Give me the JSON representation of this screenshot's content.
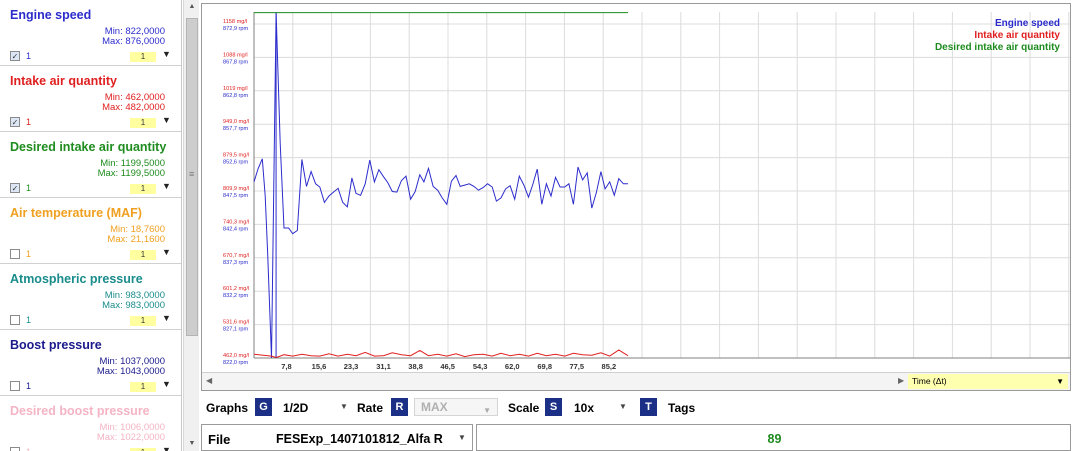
{
  "channels": [
    {
      "name": "Engine speed",
      "min": "Min: 822,0000",
      "max": "Max: 876,0000",
      "count": "1",
      "checked": true,
      "color": "#2c2ccc"
    },
    {
      "name": "Intake air quantity",
      "min": "Min: 462,0000",
      "max": "Max: 482,0000",
      "count": "1",
      "checked": true,
      "color": "#e02020"
    },
    {
      "name": "Desired intake air quantity",
      "min": "Min: 1199,5000",
      "max": "Max: 1199,5000",
      "count": "1",
      "checked": true,
      "color": "#1e8c1e"
    },
    {
      "name": "Air temperature (MAF)",
      "min": "Min: 18,7600",
      "max": "Max: 21,1600",
      "count": "1",
      "checked": false,
      "color": "#f0a020"
    },
    {
      "name": "Atmospheric pressure",
      "min": "Min: 983,0000",
      "max": "Max: 983,0000",
      "count": "1",
      "checked": false,
      "color": "#1a8c8c"
    },
    {
      "name": "Boost pressure",
      "min": "Min: 1037,0000",
      "max": "Max: 1043,0000",
      "count": "1",
      "checked": false,
      "color": "#1a1a8c"
    },
    {
      "name": "Desired boost pressure",
      "min": "Min: 1006,0000",
      "max": "Max: 1022,0000",
      "count": "1",
      "checked": false,
      "color": "#f4b4c4"
    }
  ],
  "color_swatch_label": "1",
  "icons": {
    "dropdown": "chevron-down-icon",
    "check": "check-icon",
    "scroll_up": "arrow-up-icon",
    "scroll_down": "arrow-down-icon",
    "grip": "grip-icon"
  },
  "legend": [
    {
      "label": "Engine speed",
      "color": "#2c2ccc"
    },
    {
      "label": "Intake air quantity",
      "color": "#e02020"
    },
    {
      "label": "Desired intake air quantity",
      "color": "#1e8c1e"
    }
  ],
  "xaxis_select": {
    "value": "Time (Δt)"
  },
  "toolbar": {
    "graphs_label": "Graphs",
    "graphs_key": "G",
    "graphs_value": "1/2D",
    "rate_label": "Rate",
    "rate_key": "R",
    "rate_value": "MAX",
    "scale_label": "Scale",
    "scale_key": "S",
    "scale_value": "10x",
    "tags_key": "T",
    "tags_label": "Tags"
  },
  "file": {
    "label": "File",
    "name": "FESExp_1407101812_Alfa R"
  },
  "current_value": "89",
  "chart_data": {
    "type": "line",
    "x_ticks": [
      "7,8",
      "15,6",
      "23,3",
      "31,1",
      "38,8",
      "46,5",
      "54,3",
      "62,0",
      "69,8",
      "77,5",
      "85,2"
    ],
    "y_ticks_air": [
      "1158 mg/l",
      "1088 mg/l",
      "1019 mg/l",
      "949,0 mg/l",
      "879,5 mg/l",
      "809,9 mg/l",
      "740,3 mg/l",
      "670,7 mg/l",
      "601,2 mg/l",
      "531,6 mg/l",
      "462,0 mg/l"
    ],
    "y_ticks_rpm": [
      "872,9 rpm",
      "867,8 rpm",
      "862,8 rpm",
      "857,7 rpm",
      "852,6 rpm",
      "847,5 rpm",
      "842,4 rpm",
      "837,3 rpm",
      "832,2 rpm",
      "827,1 rpm",
      "822,0 rpm"
    ],
    "xlim": [
      0,
      95
    ],
    "rpm_range": [
      822,
      872.9
    ],
    "air_range": [
      462,
      1158
    ],
    "series": [
      {
        "name": "Engine speed",
        "axis": "rpm",
        "color": "#2c2ccc",
        "x": [
          0,
          1,
          2,
          2.7,
          3.3,
          4.2,
          5.3,
          6.3,
          7.2,
          8.3,
          9.3,
          10.4,
          11.5,
          12.6,
          13.7,
          14.8,
          15.8,
          16.9,
          18.0,
          19.1,
          20.2,
          21.3,
          22.4,
          23.5,
          24.5,
          25.6,
          26.7,
          27.8,
          28.9,
          30.0,
          31.1,
          32.1,
          33.2,
          34.3,
          35.4,
          36.5,
          37.6,
          38.7,
          39.8,
          40.8,
          41.9,
          43.0,
          44.1,
          45.2,
          46.3,
          47.4,
          48.5,
          49.5,
          50.6,
          51.7,
          52.8,
          53.9,
          55.0,
          56.1,
          57.2,
          58.2,
          59.3,
          60.4,
          61.5,
          62.6,
          63.7,
          64.8,
          65.9,
          66.9,
          68.0,
          69.1,
          70.2,
          71.3,
          72.4,
          73.5,
          74.6,
          75.6,
          76.7,
          77.8,
          78.9,
          80.0,
          81.1,
          82.2,
          83.3,
          84.3,
          85.4,
          86.5,
          87.6,
          88.7,
          89.8
        ],
        "y": [
          849.5,
          851.6,
          853.1,
          847.3,
          838.2,
          822.0,
          876.0,
          855.5,
          842.3,
          842.3,
          841.4,
          841.9,
          853.0,
          848.8,
          851.1,
          849.2,
          848.7,
          846.3,
          847.3,
          847.9,
          848.5,
          846.3,
          845.6,
          850.1,
          847.7,
          847.4,
          849.2,
          852.9,
          849.5,
          851.4,
          850.3,
          849.4,
          848.0,
          847.9,
          849.7,
          850.4,
          846.8,
          848.0,
          850.6,
          849.5,
          851.6,
          848.8,
          848.2,
          847.0,
          846.0,
          849.6,
          850.5,
          848.8,
          849.0,
          849.2,
          848.8,
          848.2,
          848.6,
          849.2,
          848.7,
          846.5,
          847.0,
          848.4,
          848.9,
          846.8,
          850.4,
          849.0,
          847.1,
          849.0,
          851.5,
          846.0,
          849.2,
          847.3,
          850.2,
          848.7,
          848.7,
          849.2,
          846.0,
          851.8,
          849.8,
          850.9,
          845.4,
          847.8,
          851.1,
          848.4,
          849.5,
          847.4,
          850.0,
          849.2,
          849.2
        ]
      },
      {
        "name": "Intake air quantity",
        "axis": "air",
        "color": "#e02020",
        "x": [
          0,
          4.2,
          5.3,
          6.3,
          7.2,
          9.3,
          11.5,
          13.7,
          15.8,
          18.0,
          20.2,
          22.4,
          24.5,
          26.7,
          28.9,
          31.1,
          33.2,
          35.4,
          37.6,
          39.8,
          41.9,
          44.1,
          46.3,
          48.5,
          50.6,
          52.8,
          55.0,
          57.2,
          59.3,
          61.5,
          63.7,
          65.9,
          68.0,
          70.2,
          72.4,
          74.6,
          76.7,
          78.9,
          81.1,
          83.3,
          85.4,
          87.6,
          89.8
        ],
        "y": [
          470,
          466,
          463,
          466,
          469,
          466,
          470,
          467,
          466,
          471,
          466,
          470,
          467,
          474,
          466,
          467,
          473,
          469,
          467,
          478,
          467,
          470,
          466,
          471,
          465,
          469,
          470,
          466,
          472,
          467,
          470,
          466,
          472,
          467,
          470,
          466,
          472,
          469,
          468,
          473,
          466,
          479,
          467
        ]
      },
      {
        "name": "Desired intake air quantity",
        "axis": "air",
        "color": "#1e8c1e",
        "x": [
          0,
          89.8
        ],
        "y": [
          1199.5,
          1199.5
        ]
      }
    ]
  }
}
